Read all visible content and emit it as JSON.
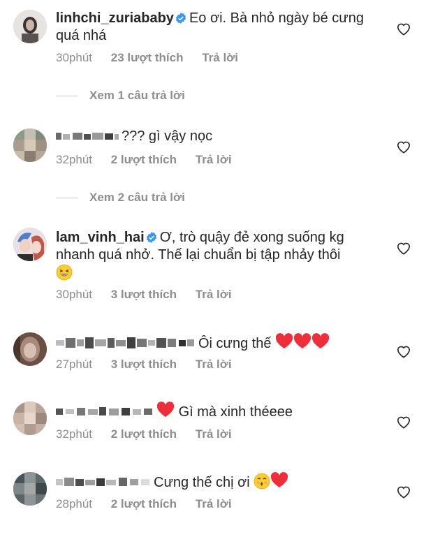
{
  "comments": [
    {
      "username": "linhchi_zuriababy",
      "text": "Eo ơi. Bà nhỏ ngày bé cưng quá nhá",
      "time": "30phút",
      "likes": "23 lượt thích",
      "reply": "Trả lời",
      "view_replies": "Xem 1 câu trả lời"
    },
    {
      "username": "",
      "text": "??? gì vậy nọc",
      "time": "32phút",
      "likes": "2 lượt thích",
      "reply": "Trả lời",
      "view_replies": "Xem 2 câu trả lời"
    },
    {
      "username": "lam_vinh_hai",
      "text": "Ơ, trò quậy đẻ xong suống kg nhanh quá nhở. Thế lại chuẩn bị tập nhảy thôi",
      "time": "30phút",
      "likes": "3 lượt thích",
      "reply": "Trả lời"
    },
    {
      "username": "",
      "text": "Ôi cưng thế",
      "time": "27phút",
      "likes": "3 lượt thích",
      "reply": "Trả lời"
    },
    {
      "username": "",
      "text": "Gì mà xinh théeee",
      "time": "32phút",
      "likes": "2 lượt thích",
      "reply": "Trả lời"
    },
    {
      "username": "",
      "text": "Cưng thế chị ơi",
      "time": "28phút",
      "likes": "2 lượt thích",
      "reply": "Trả lời"
    }
  ],
  "icons": {
    "like": "heart-outline-icon",
    "verified": "verified-badge-icon",
    "heart_emoji": "red-heart-emoji-icon",
    "laugh_emoji": "grinning-squinting-face-emoji-icon",
    "kiss_emoji": "kissing-face-emoji-icon"
  },
  "colors": {
    "text": "#262626",
    "secondary": "#8e8e8e",
    "verified": "#3897f0",
    "heart": "#ed4956"
  }
}
